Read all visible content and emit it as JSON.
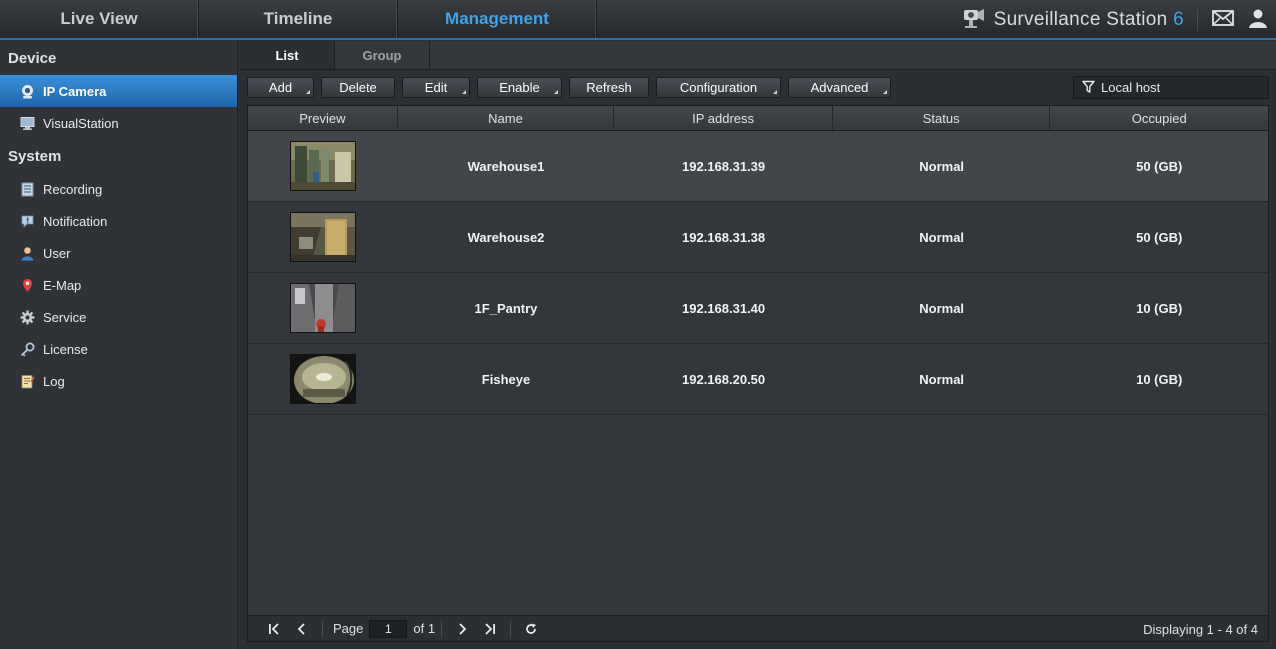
{
  "top_nav": {
    "tabs": [
      {
        "label": "Live View"
      },
      {
        "label": "Timeline"
      },
      {
        "label": "Management"
      }
    ],
    "brand": "Surveillance Station",
    "brand_version": "6",
    "icons": [
      "camera-logo-icon",
      "mail-icon",
      "user-icon"
    ]
  },
  "sidebar": {
    "sections": [
      {
        "title": "Device",
        "items": [
          {
            "label": "IP Camera",
            "icon": "ip-camera-icon",
            "active": true
          },
          {
            "label": "VisualStation",
            "icon": "monitor-icon"
          }
        ]
      },
      {
        "title": "System",
        "items": [
          {
            "label": "Recording",
            "icon": "recording-icon"
          },
          {
            "label": "Notification",
            "icon": "notification-icon"
          },
          {
            "label": "User",
            "icon": "user-icon"
          },
          {
            "label": "E-Map",
            "icon": "map-pin-icon"
          },
          {
            "label": "Service",
            "icon": "gear-icon"
          },
          {
            "label": "License",
            "icon": "key-icon"
          },
          {
            "label": "Log",
            "icon": "log-icon"
          }
        ]
      }
    ]
  },
  "subtabs": [
    {
      "label": "List"
    },
    {
      "label": "Group"
    }
  ],
  "toolbar": {
    "buttons": [
      {
        "label": "Add",
        "dropdown": true
      },
      {
        "label": "Delete",
        "dropdown": false
      },
      {
        "label": "Edit",
        "dropdown": true
      },
      {
        "label": "Enable",
        "dropdown": true
      },
      {
        "label": "Refresh",
        "dropdown": false
      },
      {
        "label": "Configuration",
        "dropdown": true
      },
      {
        "label": "Advanced",
        "dropdown": true
      }
    ]
  },
  "filter": {
    "value": "Local host",
    "icon": "filter-icon"
  },
  "table": {
    "columns": [
      "Preview",
      "Name",
      "IP address",
      "Status",
      "Occupied"
    ],
    "rows": [
      {
        "name": "Warehouse1",
        "ip": "192.168.31.39",
        "status": "Normal",
        "occupied": "50 (GB)",
        "selected": true
      },
      {
        "name": "Warehouse2",
        "ip": "192.168.31.38",
        "status": "Normal",
        "occupied": "50 (GB)"
      },
      {
        "name": "1F_Pantry",
        "ip": "192.168.31.40",
        "status": "Normal",
        "occupied": "10 (GB)"
      },
      {
        "name": "Fisheye",
        "ip": "192.168.20.50",
        "status": "Normal",
        "occupied": "10 (GB)"
      }
    ]
  },
  "pager": {
    "page_label": "Page",
    "page_value": "1",
    "of_label": "of 1",
    "display_text": "Displaying 1 - 4 of 4"
  },
  "colors": {
    "accent": "#3fa3ea",
    "active_item": "#2a7cc7"
  }
}
